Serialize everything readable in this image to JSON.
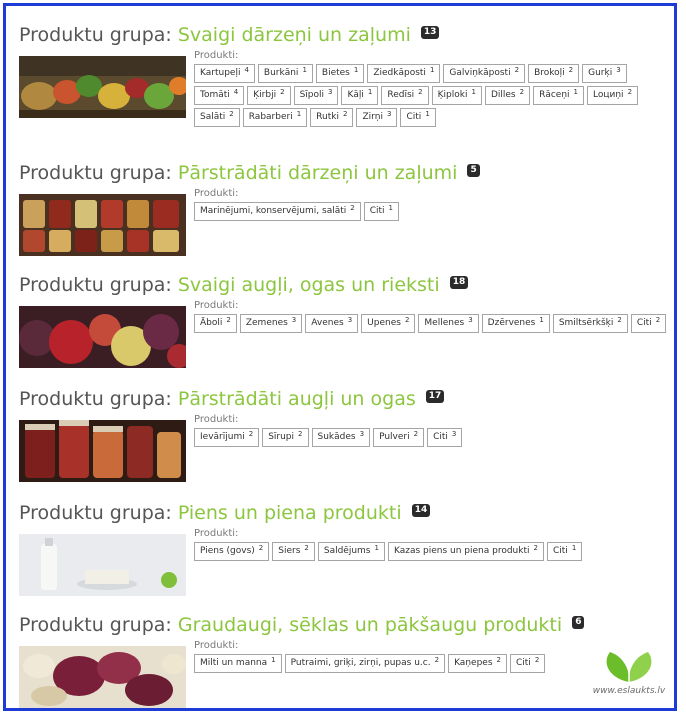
{
  "group_prefix": "Produktu grupa:",
  "products_label": "Produkti:",
  "groups": [
    {
      "name": "Svaigi dārzeņi un zaļumi",
      "count": "13",
      "image": "fresh-vegetables-photo",
      "products": [
        {
          "name": "Kartupeļi",
          "count": "4"
        },
        {
          "name": "Burkāni",
          "count": "1"
        },
        {
          "name": "Bietes",
          "count": "1"
        },
        {
          "name": "Ziedkāposti",
          "count": "1"
        },
        {
          "name": "Galviņkāposti",
          "count": "2"
        },
        {
          "name": "Brokoļi",
          "count": "2"
        },
        {
          "name": "Gurķi",
          "count": "3"
        },
        {
          "name": "Tomāti",
          "count": "4"
        },
        {
          "name": "Ķirbji",
          "count": "2"
        },
        {
          "name": "Sīpoli",
          "count": "3"
        },
        {
          "name": "Kāļi",
          "count": "1"
        },
        {
          "name": "Redīsi",
          "count": "2"
        },
        {
          "name": "Ķiploki",
          "count": "1"
        },
        {
          "name": "Dilles",
          "count": "2"
        },
        {
          "name": "Rāceņi",
          "count": "1"
        },
        {
          "name": "Loциņi",
          "count": "2"
        },
        {
          "name": "Salāti",
          "count": "2"
        },
        {
          "name": "Rabarberi",
          "count": "1"
        },
        {
          "name": "Rutki",
          "count": "2"
        },
        {
          "name": "Zirņi",
          "count": "3"
        },
        {
          "name": "Citi",
          "count": "1"
        }
      ]
    },
    {
      "name": "Pārstrādāti dārzeņi un zaļumi",
      "count": "5",
      "image": "preserved-jars-photo",
      "products": [
        {
          "name": "Marinējumi, konservējumi, salāti",
          "count": "2"
        },
        {
          "name": "Citi",
          "count": "1"
        }
      ]
    },
    {
      "name": "Svaigi augļi, ogas un rieksti",
      "count": "18",
      "image": "fresh-fruit-photo",
      "products": [
        {
          "name": "Āboli",
          "count": "2"
        },
        {
          "name": "Zemenes",
          "count": "3"
        },
        {
          "name": "Avenes",
          "count": "3"
        },
        {
          "name": "Upenes",
          "count": "2"
        },
        {
          "name": "Mellenes",
          "count": "3"
        },
        {
          "name": "Dzērvenes",
          "count": "1"
        },
        {
          "name": "Smiltsērkšķi",
          "count": "2"
        },
        {
          "name": "Citi",
          "count": "2"
        }
      ]
    },
    {
      "name": "Pārstrādāti augļi un ogas",
      "count": "17",
      "image": "fruit-jam-jars-photo",
      "products": [
        {
          "name": "Ievārījumi",
          "count": "2"
        },
        {
          "name": "Sīrupi",
          "count": "2"
        },
        {
          "name": "Sukādes",
          "count": "3"
        },
        {
          "name": "Pulveri",
          "count": "2"
        },
        {
          "name": "Citi",
          "count": "3"
        }
      ]
    },
    {
      "name": "Piens un piena produkti",
      "count": "14",
      "image": "milk-products-photo",
      "products": [
        {
          "name": "Piens (govs)",
          "count": "2"
        },
        {
          "name": "Siers",
          "count": "2"
        },
        {
          "name": "Saldējums",
          "count": "1"
        },
        {
          "name": "Kazas piens un piena produkti",
          "count": "2"
        },
        {
          "name": "Citi",
          "count": "1"
        }
      ]
    },
    {
      "name": "Graudaugi, sēklas un pākšaugu produkti",
      "count": "6",
      "image": "beans-grains-photo",
      "products": [
        {
          "name": "Milti un manna",
          "count": "1"
        },
        {
          "name": "Putraimi, griķi, zirņi, pupas u.c.",
          "count": "2"
        },
        {
          "name": "Kaņepes",
          "count": "2"
        },
        {
          "name": "Citi",
          "count": "2"
        }
      ]
    }
  ],
  "logo": {
    "text": "www.eslaukts.lv",
    "icon": "green-leaf-logo"
  }
}
